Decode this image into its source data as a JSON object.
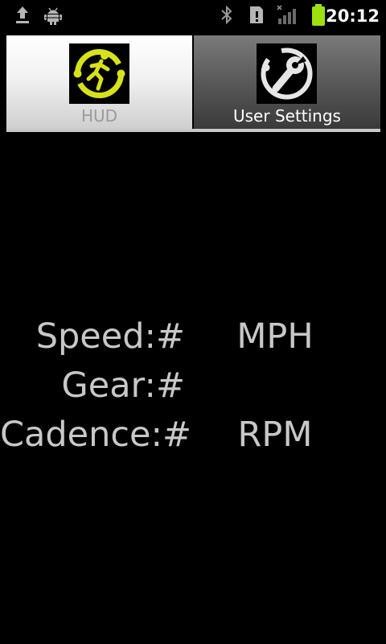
{
  "status_bar": {
    "time": "20:12",
    "battery_color": "#9ee012",
    "icons": [
      "upload-icon",
      "android-debug-icon",
      "bluetooth-icon",
      "sd-card-icon",
      "signal-icon",
      "battery-icon"
    ]
  },
  "tabs": [
    {
      "label": "HUD",
      "icon": "runner-icon",
      "selected": true,
      "accent": "#d7e21a"
    },
    {
      "label": "User Settings",
      "icon": "wrench-icon",
      "selected": false
    }
  ],
  "hud": {
    "speed_label": "Speed:#",
    "speed_unit": "MPH",
    "gear_label": "Gear:#",
    "cadence_label": "Cadence:#",
    "cadence_unit": "RPM"
  }
}
